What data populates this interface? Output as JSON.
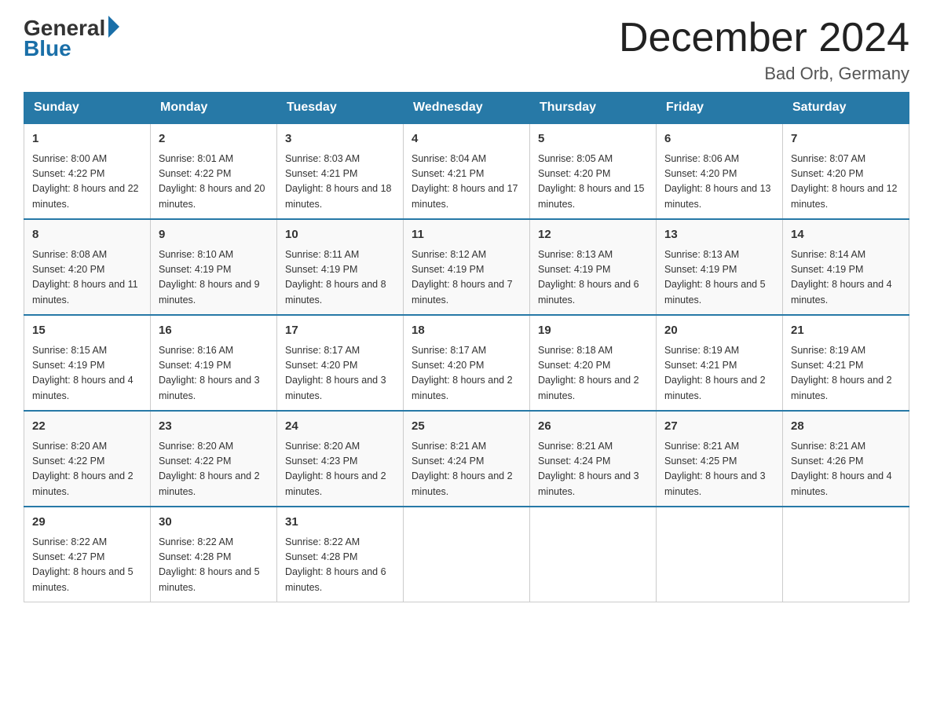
{
  "logo": {
    "general": "General",
    "blue": "Blue"
  },
  "title": "December 2024",
  "location": "Bad Orb, Germany",
  "weekdays": [
    "Sunday",
    "Monday",
    "Tuesday",
    "Wednesday",
    "Thursday",
    "Friday",
    "Saturday"
  ],
  "weeks": [
    [
      {
        "day": "1",
        "sunrise": "8:00 AM",
        "sunset": "4:22 PM",
        "daylight": "8 hours and 22 minutes."
      },
      {
        "day": "2",
        "sunrise": "8:01 AM",
        "sunset": "4:22 PM",
        "daylight": "8 hours and 20 minutes."
      },
      {
        "day": "3",
        "sunrise": "8:03 AM",
        "sunset": "4:21 PM",
        "daylight": "8 hours and 18 minutes."
      },
      {
        "day": "4",
        "sunrise": "8:04 AM",
        "sunset": "4:21 PM",
        "daylight": "8 hours and 17 minutes."
      },
      {
        "day": "5",
        "sunrise": "8:05 AM",
        "sunset": "4:20 PM",
        "daylight": "8 hours and 15 minutes."
      },
      {
        "day": "6",
        "sunrise": "8:06 AM",
        "sunset": "4:20 PM",
        "daylight": "8 hours and 13 minutes."
      },
      {
        "day": "7",
        "sunrise": "8:07 AM",
        "sunset": "4:20 PM",
        "daylight": "8 hours and 12 minutes."
      }
    ],
    [
      {
        "day": "8",
        "sunrise": "8:08 AM",
        "sunset": "4:20 PM",
        "daylight": "8 hours and 11 minutes."
      },
      {
        "day": "9",
        "sunrise": "8:10 AM",
        "sunset": "4:19 PM",
        "daylight": "8 hours and 9 minutes."
      },
      {
        "day": "10",
        "sunrise": "8:11 AM",
        "sunset": "4:19 PM",
        "daylight": "8 hours and 8 minutes."
      },
      {
        "day": "11",
        "sunrise": "8:12 AM",
        "sunset": "4:19 PM",
        "daylight": "8 hours and 7 minutes."
      },
      {
        "day": "12",
        "sunrise": "8:13 AM",
        "sunset": "4:19 PM",
        "daylight": "8 hours and 6 minutes."
      },
      {
        "day": "13",
        "sunrise": "8:13 AM",
        "sunset": "4:19 PM",
        "daylight": "8 hours and 5 minutes."
      },
      {
        "day": "14",
        "sunrise": "8:14 AM",
        "sunset": "4:19 PM",
        "daylight": "8 hours and 4 minutes."
      }
    ],
    [
      {
        "day": "15",
        "sunrise": "8:15 AM",
        "sunset": "4:19 PM",
        "daylight": "8 hours and 4 minutes."
      },
      {
        "day": "16",
        "sunrise": "8:16 AM",
        "sunset": "4:19 PM",
        "daylight": "8 hours and 3 minutes."
      },
      {
        "day": "17",
        "sunrise": "8:17 AM",
        "sunset": "4:20 PM",
        "daylight": "8 hours and 3 minutes."
      },
      {
        "day": "18",
        "sunrise": "8:17 AM",
        "sunset": "4:20 PM",
        "daylight": "8 hours and 2 minutes."
      },
      {
        "day": "19",
        "sunrise": "8:18 AM",
        "sunset": "4:20 PM",
        "daylight": "8 hours and 2 minutes."
      },
      {
        "day": "20",
        "sunrise": "8:19 AM",
        "sunset": "4:21 PM",
        "daylight": "8 hours and 2 minutes."
      },
      {
        "day": "21",
        "sunrise": "8:19 AM",
        "sunset": "4:21 PM",
        "daylight": "8 hours and 2 minutes."
      }
    ],
    [
      {
        "day": "22",
        "sunrise": "8:20 AM",
        "sunset": "4:22 PM",
        "daylight": "8 hours and 2 minutes."
      },
      {
        "day": "23",
        "sunrise": "8:20 AM",
        "sunset": "4:22 PM",
        "daylight": "8 hours and 2 minutes."
      },
      {
        "day": "24",
        "sunrise": "8:20 AM",
        "sunset": "4:23 PM",
        "daylight": "8 hours and 2 minutes."
      },
      {
        "day": "25",
        "sunrise": "8:21 AM",
        "sunset": "4:24 PM",
        "daylight": "8 hours and 2 minutes."
      },
      {
        "day": "26",
        "sunrise": "8:21 AM",
        "sunset": "4:24 PM",
        "daylight": "8 hours and 3 minutes."
      },
      {
        "day": "27",
        "sunrise": "8:21 AM",
        "sunset": "4:25 PM",
        "daylight": "8 hours and 3 minutes."
      },
      {
        "day": "28",
        "sunrise": "8:21 AM",
        "sunset": "4:26 PM",
        "daylight": "8 hours and 4 minutes."
      }
    ],
    [
      {
        "day": "29",
        "sunrise": "8:22 AM",
        "sunset": "4:27 PM",
        "daylight": "8 hours and 5 minutes."
      },
      {
        "day": "30",
        "sunrise": "8:22 AM",
        "sunset": "4:28 PM",
        "daylight": "8 hours and 5 minutes."
      },
      {
        "day": "31",
        "sunrise": "8:22 AM",
        "sunset": "4:28 PM",
        "daylight": "8 hours and 6 minutes."
      },
      null,
      null,
      null,
      null
    ]
  ]
}
